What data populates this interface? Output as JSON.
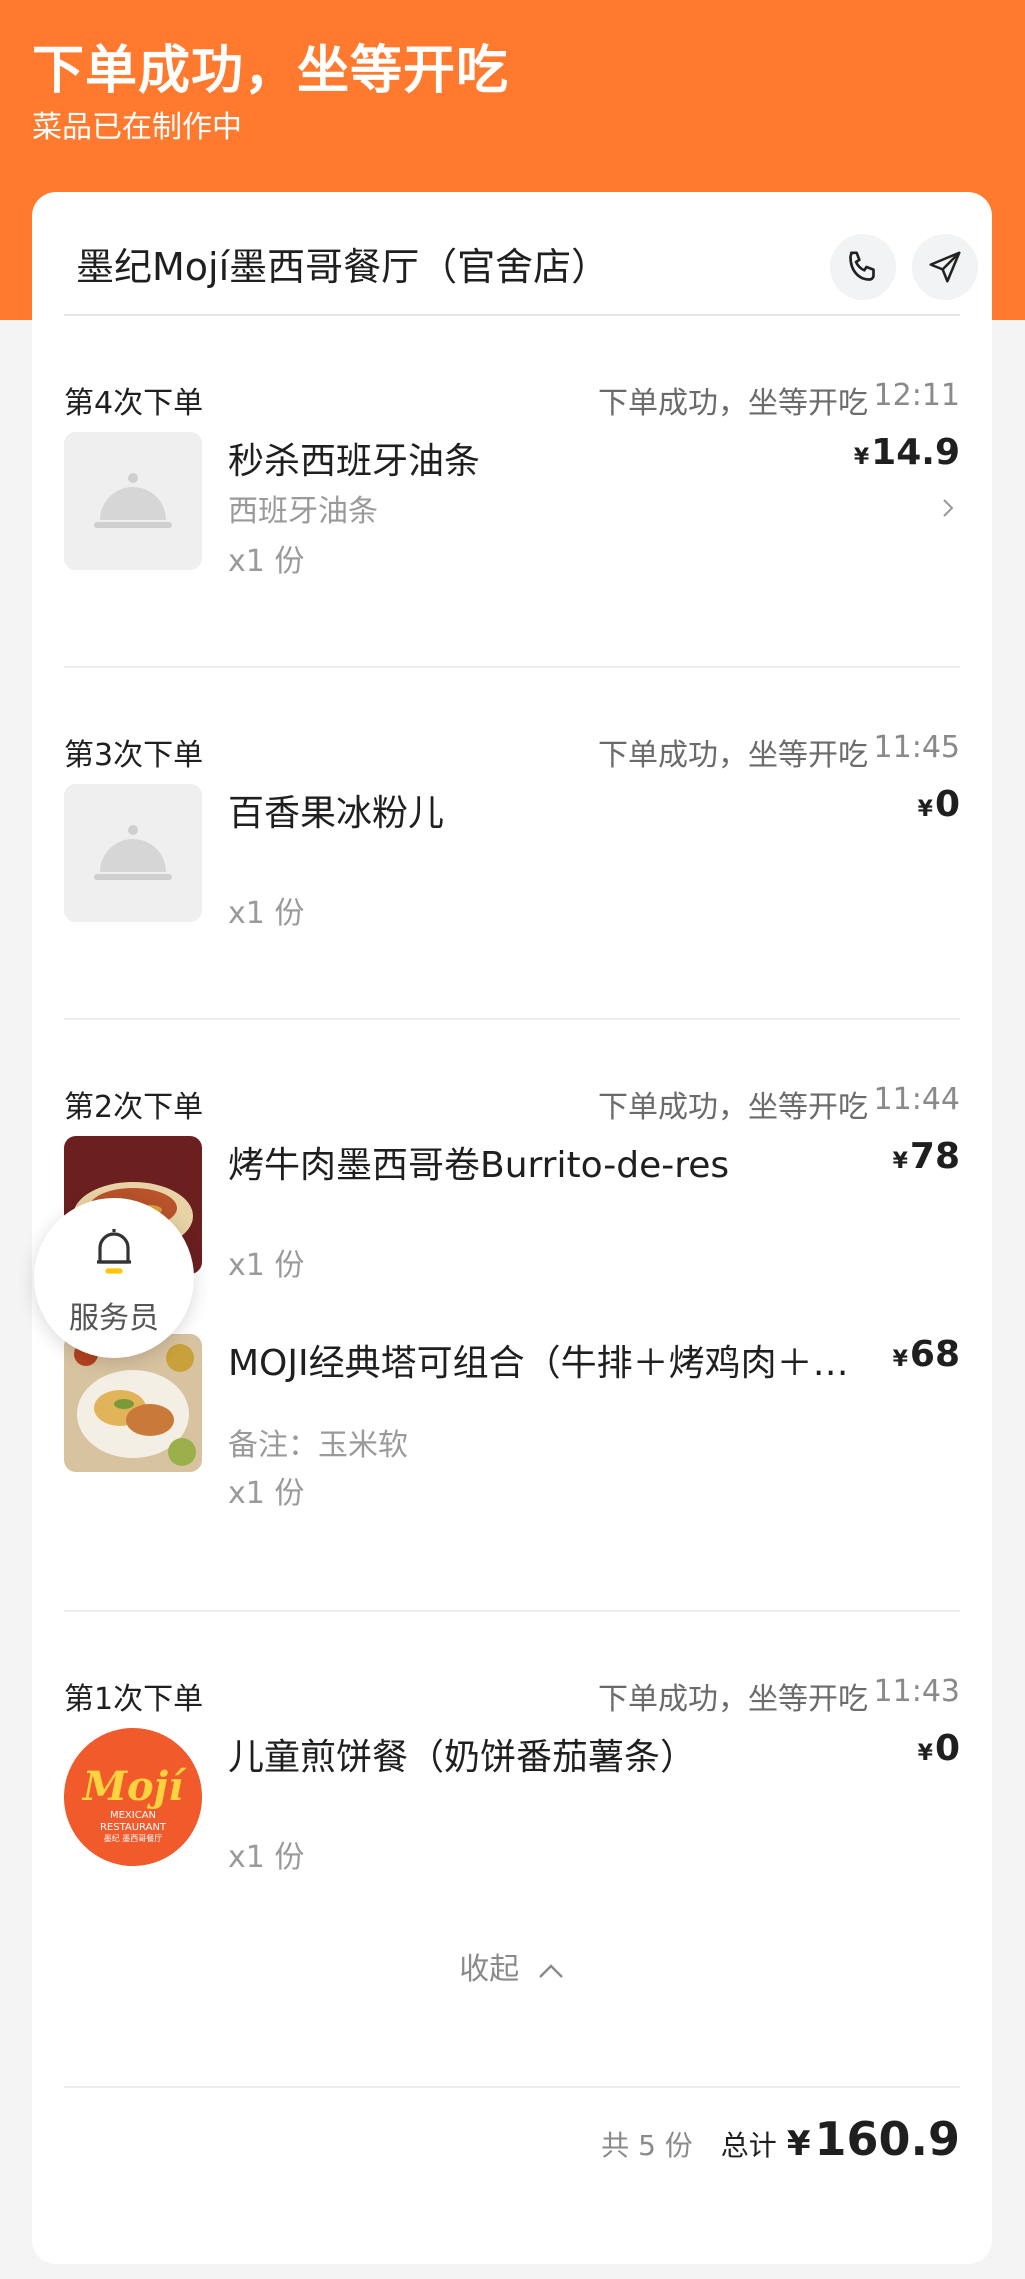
{
  "hero": {
    "title": "下单成功，坐等开吃",
    "subtitle": "菜品已在制作中"
  },
  "store": {
    "name": "墨纪Mojí墨西哥餐厅（官舍店）",
    "phone_icon": "phone-icon",
    "nav_icon": "navigation-icon"
  },
  "orders": [
    {
      "label": "第4次下单",
      "status": "下单成功，坐等开吃",
      "time": "12:11",
      "items": [
        {
          "name": "秒杀西班牙油条",
          "sub": "西班牙油条",
          "qty": "x1 份",
          "yen": "¥",
          "price": "14.9",
          "thumb": "placeholder"
        }
      ]
    },
    {
      "label": "第3次下单",
      "status": "下单成功，坐等开吃",
      "time": "11:45",
      "items": [
        {
          "name": "百香果冰粉儿",
          "qty": "x1 份",
          "yen": "¥",
          "price": "0",
          "thumb": "placeholder"
        }
      ]
    },
    {
      "label": "第2次下单",
      "status": "下单成功，坐等开吃",
      "time": "11:44",
      "items": [
        {
          "name": "烤牛肉墨西哥卷Burrito-de-res",
          "qty": "x1 份",
          "yen": "¥",
          "price": "78",
          "thumb": "photo"
        },
        {
          "name": "MOJI经典塔可组合（牛排＋烤鸡肉＋…",
          "note": "备注：玉米软",
          "qty": "x1 份",
          "yen": "¥",
          "price": "68",
          "thumb": "photo"
        }
      ]
    },
    {
      "label": "第1次下单",
      "status": "下单成功，坐等开吃",
      "time": "11:43",
      "items": [
        {
          "name": "儿童煎饼餐（奶饼番茄薯条）",
          "qty": "x1 份",
          "yen": "¥",
          "price": "0",
          "thumb": "logo"
        }
      ]
    }
  ],
  "logo": {
    "word": "Mojí",
    "line1": "MEXICAN",
    "line2": "RESTAURANT",
    "line3": "墨纪 墨西哥餐厅"
  },
  "collapse_label": "收起",
  "summary": {
    "count": "共 5 份",
    "label": "总计",
    "yen": "¥",
    "total": "160.9"
  },
  "waiter": {
    "label": "服务员"
  },
  "colors": {
    "accent": "#ff7a2e",
    "logo_bg": "#f15a2b",
    "logo_text": "#ffd23f"
  }
}
